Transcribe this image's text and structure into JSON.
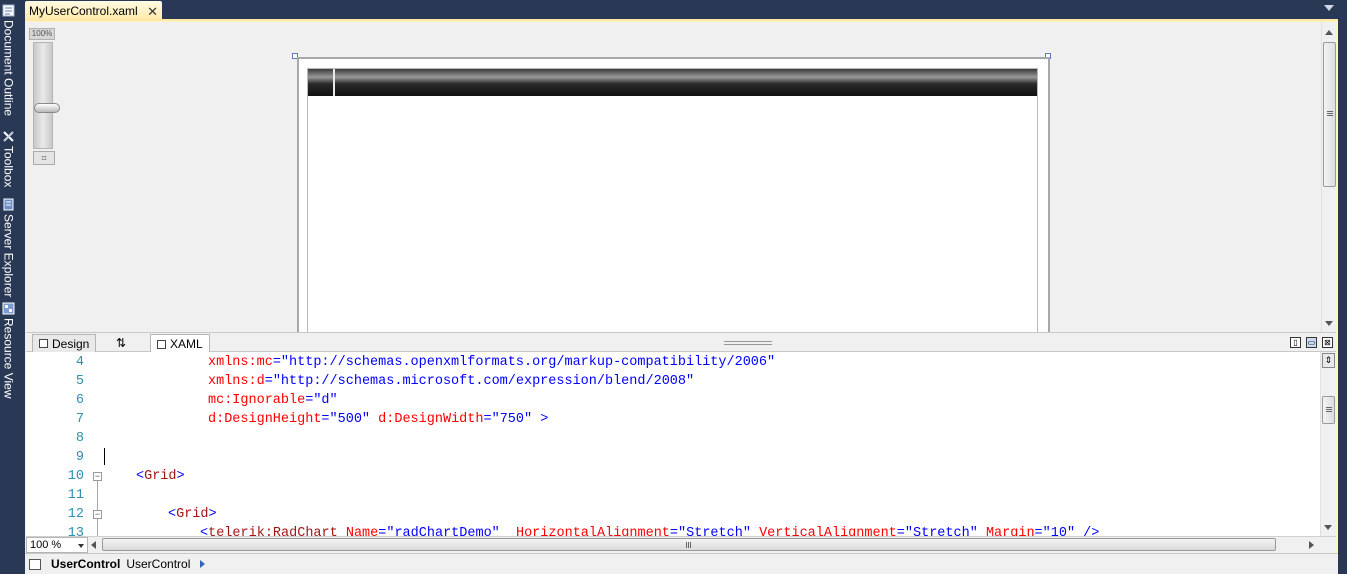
{
  "left_rail": {
    "items": [
      {
        "label": "Document Outline",
        "icon": "document-outline-icon"
      },
      {
        "label": "Toolbox",
        "icon": "toolbox-icon"
      },
      {
        "label": "Server Explorer",
        "icon": "server-explorer-icon"
      },
      {
        "label": "Resource View",
        "icon": "resource-view-icon"
      }
    ]
  },
  "document_tab": {
    "label": "MyUserControl.xaml",
    "close_glyph": "✕"
  },
  "designer": {
    "zoom_slider_label": "100%",
    "zoom_slider_level": 0.43
  },
  "view_tabs": {
    "design_label": "Design",
    "swap_glyph": "⇅",
    "xaml_label": "XAML"
  },
  "editor": {
    "lines": [
      {
        "num": "4",
        "parts": [
          {
            "t": "xmlns:mc",
            "c": "attr"
          },
          {
            "t": "=",
            "c": "punct"
          },
          {
            "t": "\"http://schemas.openxmlformats.org/markup-compatibility/2006\"",
            "c": "val"
          }
        ]
      },
      {
        "num": "5",
        "parts": [
          {
            "t": "xmlns:d",
            "c": "attr"
          },
          {
            "t": "=",
            "c": "punct"
          },
          {
            "t": "\"http://schemas.microsoft.com/expression/blend/2008\"",
            "c": "val"
          }
        ]
      },
      {
        "num": "6",
        "parts": [
          {
            "t": "mc:Ignorable",
            "c": "attr"
          },
          {
            "t": "=",
            "c": "punct"
          },
          {
            "t": "\"d\"",
            "c": "val"
          }
        ]
      },
      {
        "num": "7",
        "parts": [
          {
            "t": "d:DesignHeight",
            "c": "attr"
          },
          {
            "t": "=",
            "c": "punct"
          },
          {
            "t": "\"500\"",
            "c": "val"
          },
          {
            "t": " ",
            "c": "punct"
          },
          {
            "t": "d:DesignWidth",
            "c": "attr"
          },
          {
            "t": "=",
            "c": "punct"
          },
          {
            "t": "\"750\"",
            "c": "val"
          },
          {
            "t": " >",
            "c": "punct"
          }
        ]
      },
      {
        "num": "8",
        "parts": []
      },
      {
        "num": "9",
        "parts": []
      },
      {
        "num": "10",
        "parts": [
          {
            "t": "<",
            "c": "punct"
          },
          {
            "t": "Grid",
            "c": "elem"
          },
          {
            "t": ">",
            "c": "punct"
          }
        ]
      },
      {
        "num": "11",
        "parts": []
      },
      {
        "num": "12",
        "parts": [
          {
            "t": "<",
            "c": "punct"
          },
          {
            "t": "Grid",
            "c": "elem"
          },
          {
            "t": ">",
            "c": "punct"
          }
        ]
      },
      {
        "num": "13",
        "parts": [
          {
            "t": "<",
            "c": "punct"
          },
          {
            "t": "telerik:RadChart",
            "c": "elem"
          },
          {
            "t": " ",
            "c": "punct"
          },
          {
            "t": "Name",
            "c": "attr"
          },
          {
            "t": "=",
            "c": "punct"
          },
          {
            "t": "\"radChartDemo\"",
            "c": "val"
          },
          {
            "t": "  ",
            "c": "punct"
          },
          {
            "t": "HorizontalAlignment",
            "c": "attr"
          },
          {
            "t": "=",
            "c": "punct"
          },
          {
            "t": "\"Stretch\"",
            "c": "val"
          },
          {
            "t": " ",
            "c": "punct"
          },
          {
            "t": "VerticalAlignment",
            "c": "attr"
          },
          {
            "t": "=",
            "c": "punct"
          },
          {
            "t": "\"Stretch\"",
            "c": "val"
          },
          {
            "t": " ",
            "c": "punct"
          },
          {
            "t": "Margin",
            "c": "attr"
          },
          {
            "t": "=",
            "c": "punct"
          },
          {
            "t": "\"10\"",
            "c": "val"
          },
          {
            "t": " />",
            "c": "punct"
          }
        ]
      }
    ]
  },
  "bottom_bar": {
    "zoom_value": "100 %"
  },
  "breadcrumb": {
    "bold_label": "UserControl",
    "plain_label": "UserControl"
  }
}
